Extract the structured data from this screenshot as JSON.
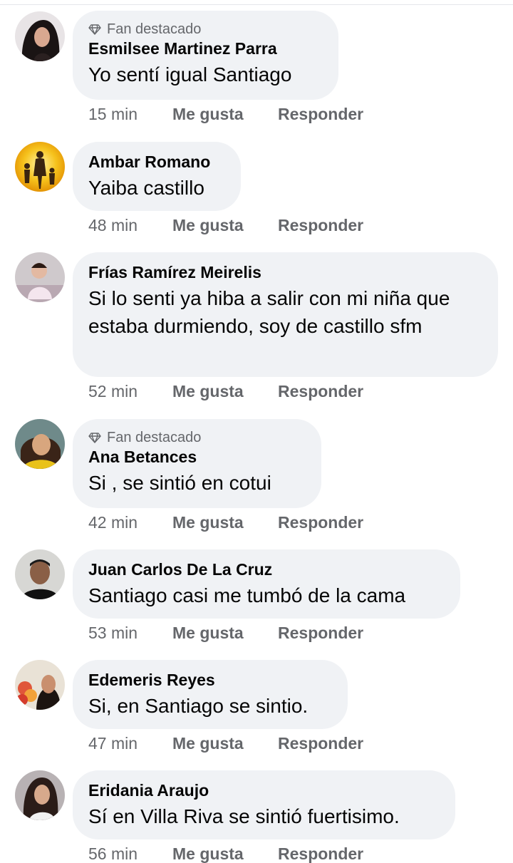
{
  "actions": {
    "like_label": "Me gusta",
    "reply_label": "Responder"
  },
  "comments": [
    {
      "badge": "Fan destacado",
      "author": "Esmilsee Martinez Parra",
      "text": "Yo sentí igual Santiago",
      "time": "15 min"
    },
    {
      "badge": "",
      "author": "Ambar Romano",
      "text": "Yaiba castillo",
      "time": "48 min"
    },
    {
      "badge": "",
      "author": "Frías Ramírez Meirelis",
      "text": "Si lo senti ya hiba a salir con mi niña que estaba durmiendo, soy de castillo sfm",
      "time": "52 min"
    },
    {
      "badge": "Fan destacado",
      "author": "Ana Betances",
      "text": "Si , se sintió en cotui",
      "time": "42 min"
    },
    {
      "badge": "",
      "author": "Juan Carlos De La Cruz",
      "text": "Santiago casi me tumbó de la cama",
      "time": "53 min"
    },
    {
      "badge": "",
      "author": "Edemeris Reyes",
      "text": "Si, en Santiago se sintio.",
      "time": "47 min"
    },
    {
      "badge": "",
      "author": "Eridania Araujo",
      "text": "Sí en Villa Riva se sintió fuertisimo.",
      "time": "56 min"
    }
  ]
}
